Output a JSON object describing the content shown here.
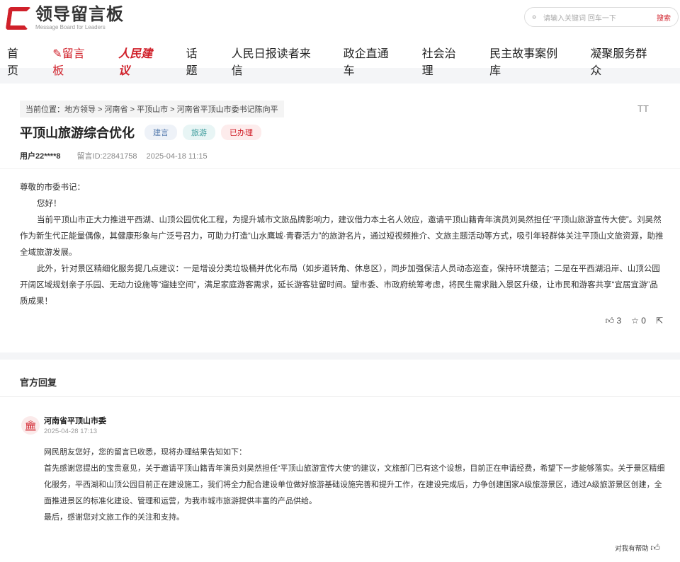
{
  "header": {
    "logo_cn": "领导留言板",
    "logo_en": "Message Board for Leaders",
    "search_placeholder": "请输入关键词 回车一下",
    "search_button": "搜索"
  },
  "nav": [
    "首页",
    "留言板",
    "人民建议",
    "话题",
    "人民日报读者来信",
    "政企直通车",
    "社会治理",
    "民主故事案例库",
    "凝聚服务群众"
  ],
  "post": {
    "breadcrumb": "当前位置：地方领导 > 河南省 > 平顶山市 > 河南省平顶山市委书记陈向平",
    "font_toggle": "TT",
    "title": "平顶山旅游综合优化",
    "tags": [
      "建言",
      "旅游",
      "已办理"
    ],
    "user": "用户22****8",
    "message_id": "留言ID:22841758",
    "date": "2025-04-18 11:15",
    "paragraphs": [
      "尊敬的市委书记：",
      "您好！",
      "当前平顶山市正大力推进平西湖、山顶公园优化工程，为提升城市文旅品牌影响力，建议借力本土名人效应，邀请平顶山籍青年演员刘昊然担任“平顶山旅游宣传大使”。刘昊然作为新生代正能量偶像，其健康形象与广泛号召力，可助力打造“山水鹰城·青春活力”的旅游名片，通过短视频推介、文旅主题活动等方式，吸引年轻群体关注平顶山文旅资源，助推全域旅游发展。",
      "此外，针对景区精细化服务提几点建议：一是增设分类垃圾桶并优化布局（如步道转角、休息区），同步加强保洁人员动态巡查，保持环境整洁；二是在平西湖沿岸、山顶公园开阔区域规划亲子乐园、无动力设施等“遛娃空间”，满足家庭游客需求，延长游客驻留时间。望市委、市政府统筹考虑，将民生需求融入景区升级，让市民和游客共享“宜居宜游”品质成果！"
    ],
    "likes": "3",
    "favorites": "0"
  },
  "reply": {
    "heading": "官方回复",
    "org": "河南省平顶山市委",
    "date": "2025-04-28 17:13",
    "paragraphs": [
      "网民朋友您好，您的留言已收悉，现将办理结果告知如下：",
      "首先感谢您提出的宝贵意见，关于邀请平顶山籍青年演员刘昊然担任“平顶山旅游宣传大使”的建议，文旅部门已有这个设想，目前正在申请经费，希望下一步能够落实。关于景区精细化服务，平西湖和山顶公园目前正在建设施工，我们将全力配合建设单位做好旅游基础设施完善和提升工作，在建设完成后，力争创建国家A级旅游景区，通过A级旅游景区创建，全面推进景区的标准化建设、管理和运营，为我市城市旅游提供丰富的产品供给。",
      "最后，感谢您对文旅工作的关注和支持。"
    ],
    "helpful": "对我有帮助"
  },
  "colors": {
    "brand": "#d0202a"
  }
}
